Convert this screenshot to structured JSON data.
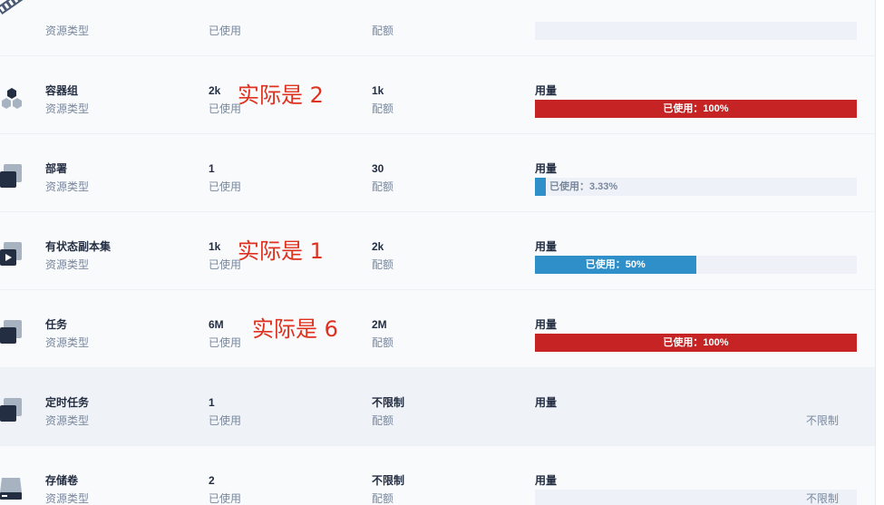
{
  "rows": [
    {
      "name": "",
      "name_label": "资源类型",
      "used": "",
      "used_label": "已使用",
      "quota": "",
      "quota_label": "配额",
      "usage_label": "",
      "bar_text": ""
    },
    {
      "name": "容器组",
      "name_label": "资源类型",
      "used": "2k",
      "used_label": "已使用",
      "quota": "1k",
      "quota_label": "配额",
      "usage_label": "用量",
      "bar_text": "已使用：100%",
      "percent": 100
    },
    {
      "name": "部署",
      "name_label": "资源类型",
      "used": "1",
      "used_label": "已使用",
      "quota": "30",
      "quota_label": "配额",
      "usage_label": "用量",
      "bar_text": "已使用：3.33%",
      "percent": 3.33
    },
    {
      "name": "有状态副本集",
      "name_label": "资源类型",
      "used": "1k",
      "used_label": "已使用",
      "quota": "2k",
      "quota_label": "配额",
      "usage_label": "用量",
      "bar_text": "已使用：50%",
      "percent": 50
    },
    {
      "name": "任务",
      "name_label": "资源类型",
      "used": "6M",
      "used_label": "已使用",
      "quota": "2M",
      "quota_label": "配额",
      "usage_label": "用量",
      "bar_text": "已使用：100%",
      "percent": 100
    },
    {
      "name": "定时任务",
      "name_label": "资源类型",
      "used": "1",
      "used_label": "已使用",
      "quota": "不限制",
      "quota_label": "配额",
      "usage_label": "用量",
      "bar_text": "不限制"
    },
    {
      "name": "存储卷",
      "name_label": "资源类型",
      "used": "2",
      "used_label": "已使用",
      "quota": "不限制",
      "quota_label": "配额",
      "usage_label": "用量",
      "bar_text": "不限制"
    }
  ],
  "annotations": {
    "pods": "实际是 2",
    "statefulsets": "实际是 1",
    "jobs": "实际是 6"
  },
  "colors": {
    "full": "#c62424",
    "partial": "#2f8fc8",
    "track": "#eef2f8",
    "annotation": "#e0301e"
  }
}
